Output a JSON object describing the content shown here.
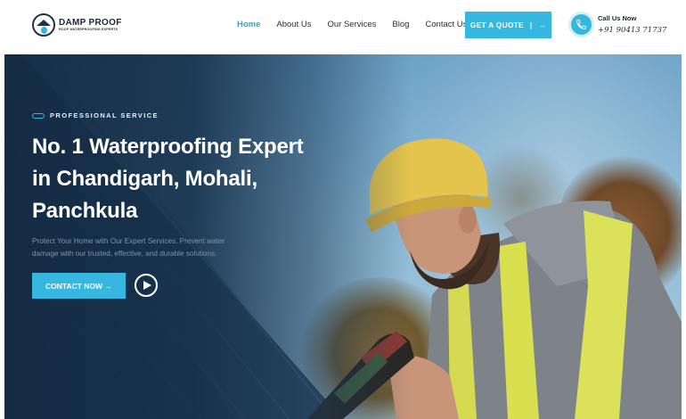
{
  "brand": {
    "title": "DAMP PROOF",
    "tagline": "ROOF WATERPROOFING EXPERTS",
    "logo_icon": "house-drop-icon"
  },
  "nav": {
    "items": [
      {
        "label": "Home",
        "active": true
      },
      {
        "label": "About Us",
        "active": false
      },
      {
        "label": "Our Services",
        "active": false
      },
      {
        "label": "Blog",
        "active": false
      },
      {
        "label": "Contact Us",
        "active": false
      }
    ]
  },
  "header_cta": {
    "label": "GET A QUOTE",
    "separator": "|",
    "arrow": "→"
  },
  "call": {
    "icon": "phone-icon",
    "label": "Call Us Now",
    "number": "+91 90413 71737"
  },
  "hero": {
    "eyebrow": "PROFESSIONAL SERVICE",
    "headline_lines": [
      "No. 1 Waterproofing Expert",
      "in Chandigarh, Mohali,",
      "Panchkula"
    ],
    "description": "Protect Your Home with Our Expert Services. Prevent water damage with our trusted, effective, and durable solutions.",
    "cta_label": "CONTACT NOW →",
    "play_icon": "play-icon"
  },
  "colors": {
    "accent": "#35b7e0",
    "nav_active": "#2aa7c9",
    "hero_overlay": "#16314c",
    "text_dark": "#1e2630"
  }
}
